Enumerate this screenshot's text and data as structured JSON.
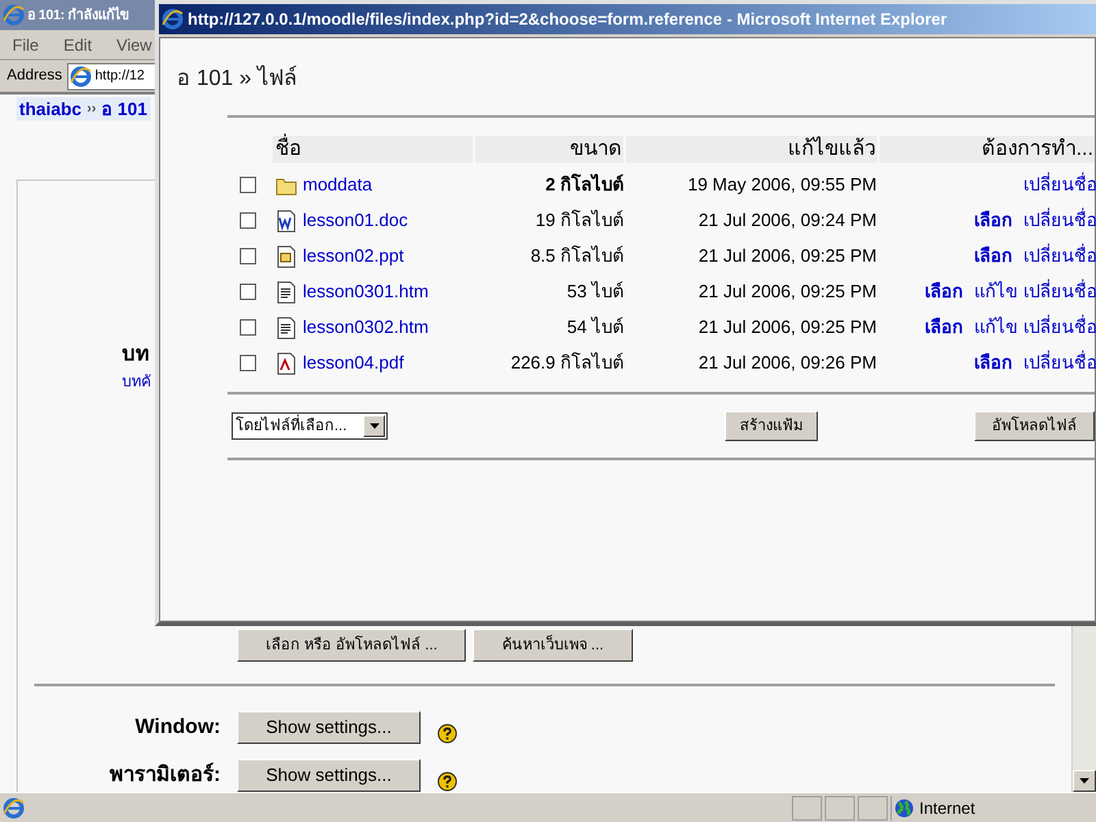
{
  "browser": {
    "title": "อ 101: กำลังแก้ไข",
    "menu": [
      "File",
      "Edit",
      "View"
    ],
    "address_label": "Address",
    "address": "http://12"
  },
  "page": {
    "breadcrumb": [
      {
        "kind": "link",
        "text": "thaiabc"
      },
      {
        "kind": "separator",
        "text": "››"
      },
      {
        "kind": "link",
        "text": "อ 101"
      }
    ],
    "field_label": "บท",
    "field_link": "บทคั",
    "reference_buttons": [
      "เลือก หรือ อัพโหลดไฟล์ ...",
      "ค้นหาเว็บเพจ ..."
    ],
    "settings": [
      {
        "label": "Window:",
        "button": "Show settings..."
      },
      {
        "label": "พารามิเตอร์:",
        "button": "Show settings..."
      }
    ]
  },
  "popup": {
    "title": "http://127.0.0.1/moodle/files/index.php?id=2&choose=form.reference - Microsoft Internet Explorer",
    "breadcrumb": "อ 101 » ไฟล์",
    "columns": [
      "ชื่อ",
      "ขนาด",
      "แก้ไขแล้ว",
      "ต้องการทำ..."
    ],
    "rows": [
      {
        "kind": "folder",
        "name": "moddata",
        "size": "2 กิโลไบต์",
        "modified": "19 May 2006, 09:55 PM",
        "checked": false,
        "actions": [
          {
            "kind": "rename",
            "label": "เปลี่ยนชื่อ"
          }
        ]
      },
      {
        "kind": "doc",
        "name": "lesson01.doc",
        "size": "19 กิโลไบต์",
        "modified": "21 Jul 2006, 09:24 PM",
        "checked": false,
        "actions": [
          {
            "kind": "choose",
            "label": "เลือก"
          },
          {
            "kind": "rename",
            "label": "เปลี่ยนชื่อ"
          }
        ]
      },
      {
        "kind": "ppt",
        "name": "lesson02.ppt",
        "size": "8.5 กิโลไบต์",
        "modified": "21 Jul 2006, 09:25 PM",
        "checked": false,
        "actions": [
          {
            "kind": "choose",
            "label": "เลือก"
          },
          {
            "kind": "rename",
            "label": "เปลี่ยนชื่อ"
          }
        ]
      },
      {
        "kind": "htm",
        "name": "lesson0301.htm",
        "size": "53 ไบต์",
        "modified": "21 Jul 2006, 09:25 PM",
        "checked": false,
        "actions": [
          {
            "kind": "choose",
            "label": "เลือก"
          },
          {
            "kind": "edit",
            "label": "แก้ไข"
          },
          {
            "kind": "rename",
            "label": "เปลี่ยนชื่อ"
          }
        ]
      },
      {
        "kind": "htm",
        "name": "lesson0302.htm",
        "size": "54 ไบต์",
        "modified": "21 Jul 2006, 09:25 PM",
        "checked": false,
        "actions": [
          {
            "kind": "choose",
            "label": "เลือก"
          },
          {
            "kind": "edit",
            "label": "แก้ไข"
          },
          {
            "kind": "rename",
            "label": "เปลี่ยนชื่อ"
          }
        ]
      },
      {
        "kind": "pdf",
        "name": "lesson04.pdf",
        "size": "226.9 กิโลไบต์",
        "modified": "21 Jul 2006, 09:26 PM",
        "checked": false,
        "actions": [
          {
            "kind": "choose",
            "label": "เลือก"
          },
          {
            "kind": "rename",
            "label": "เปลี่ยนชื่อ"
          }
        ]
      }
    ],
    "bulk_select": "โดยไฟล์ที่เลือก...",
    "buttons": [
      "สร้างแฟ้ม",
      "อัพโหลดไฟล์"
    ]
  },
  "status_bar": {
    "zone": "Internet"
  }
}
